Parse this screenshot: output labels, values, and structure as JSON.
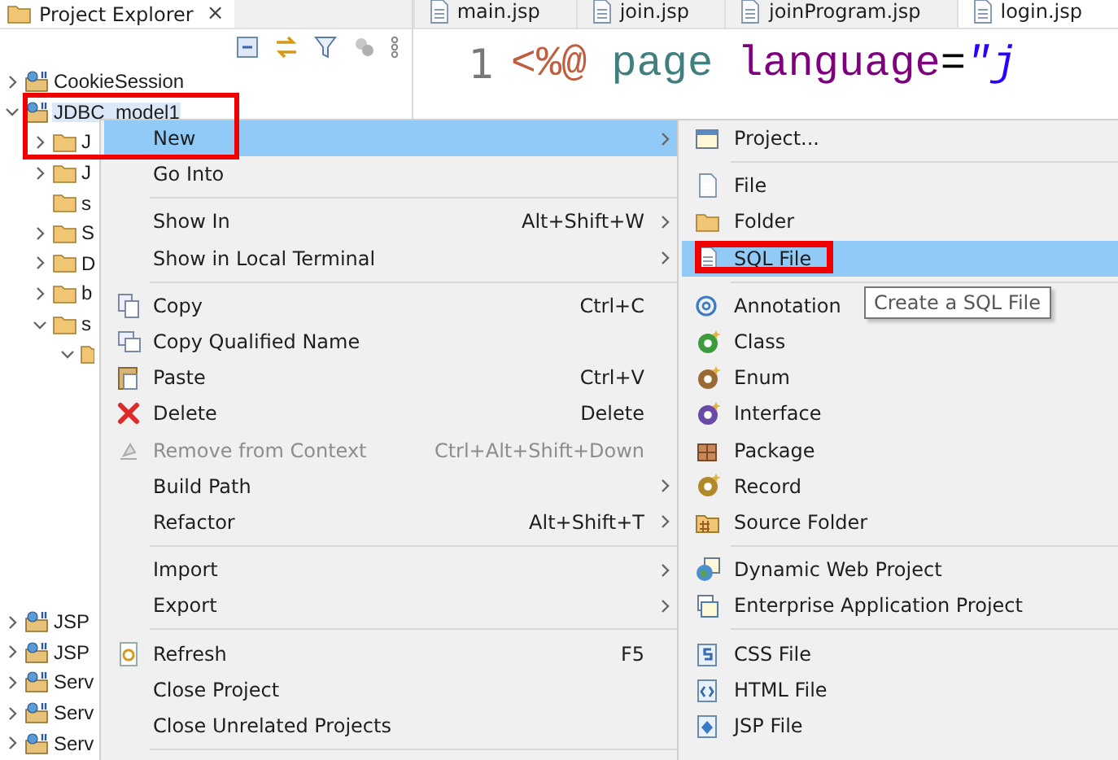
{
  "explorer": {
    "title": "Project Explorer",
    "close": "×",
    "tree": [
      {
        "label": "CookieSession",
        "expanded": false,
        "selected": false
      },
      {
        "label": "JDBC_model1",
        "expanded": true,
        "selected": true,
        "children": [
          {
            "label": "J",
            "expanded": false,
            "selected": false
          },
          {
            "label": "J",
            "expanded": false,
            "selected": false
          },
          {
            "label": "s",
            "selected": false
          },
          {
            "label": "S",
            "expanded": false,
            "selected": false
          },
          {
            "label": "D",
            "expanded": false,
            "selected": false
          },
          {
            "label": "b",
            "expanded": false,
            "selected": false
          },
          {
            "label": "s",
            "expanded": true,
            "selected": false,
            "children": [
              {
                "expanded": true,
                "selected": false
              }
            ]
          }
        ]
      },
      {
        "label": "JSP",
        "expanded": false,
        "selected": false
      },
      {
        "label": "JSP",
        "expanded": false,
        "selected": false
      },
      {
        "label": "Serv",
        "expanded": false,
        "selected": false
      },
      {
        "label": "Serv",
        "expanded": false,
        "selected": false
      },
      {
        "label": "Serv",
        "expanded": false,
        "selected": false
      }
    ]
  },
  "editor": {
    "tabs": [
      {
        "label": "main.jsp",
        "selected": false
      },
      {
        "label": "join.jsp",
        "selected": false
      },
      {
        "label": "joinProgram.jsp",
        "selected": false
      },
      {
        "label": "login.jsp",
        "selected": true
      }
    ],
    "lines": [
      {
        "number": "1",
        "tokens": [
          {
            "kind": "directive",
            "text": "<%@"
          },
          {
            "kind": "tag",
            "text": "page"
          },
          {
            "kind": "attribute",
            "text": "language"
          },
          {
            "kind": "plain",
            "text": "="
          },
          {
            "kind": "string",
            "text": "\"j"
          }
        ]
      }
    ]
  },
  "context_menu": {
    "items": [
      {
        "kind": "item",
        "label": "New",
        "has_submenu": true,
        "selected": true,
        "disabled": false
      },
      {
        "kind": "item",
        "label": "Go Into",
        "has_submenu": false,
        "selected": false,
        "disabled": false
      },
      {
        "kind": "separator"
      },
      {
        "kind": "item",
        "label": "Show In",
        "shortcut": "Alt+Shift+W",
        "has_submenu": true,
        "selected": false,
        "disabled": false
      },
      {
        "kind": "item",
        "label": "Show in Local Terminal",
        "has_submenu": true,
        "selected": false,
        "disabled": false
      },
      {
        "kind": "separator"
      },
      {
        "kind": "item",
        "label": "Copy",
        "shortcut": "Ctrl+C",
        "has_submenu": false,
        "selected": false,
        "disabled": false
      },
      {
        "kind": "item",
        "label": "Copy Qualified Name",
        "has_submenu": false,
        "selected": false,
        "disabled": false
      },
      {
        "kind": "item",
        "label": "Paste",
        "shortcut": "Ctrl+V",
        "has_submenu": false,
        "selected": false,
        "disabled": false
      },
      {
        "kind": "item",
        "label": "Delete",
        "shortcut": "Delete",
        "has_submenu": false,
        "selected": false,
        "disabled": false
      },
      {
        "kind": "item",
        "label": "Remove from Context",
        "shortcut": "Ctrl+Alt+Shift+Down",
        "has_submenu": false,
        "selected": false,
        "disabled": true
      },
      {
        "kind": "item",
        "label": "Build Path",
        "has_submenu": true,
        "selected": false,
        "disabled": false
      },
      {
        "kind": "item",
        "label": "Refactor",
        "shortcut": "Alt+Shift+T",
        "has_submenu": true,
        "selected": false,
        "disabled": false
      },
      {
        "kind": "separator"
      },
      {
        "kind": "item",
        "label": "Import",
        "has_submenu": true,
        "selected": false,
        "disabled": false
      },
      {
        "kind": "item",
        "label": "Export",
        "has_submenu": true,
        "selected": false,
        "disabled": false
      },
      {
        "kind": "separator"
      },
      {
        "kind": "item",
        "label": "Refresh",
        "shortcut": "F5",
        "has_submenu": false,
        "selected": false,
        "disabled": false
      },
      {
        "kind": "item",
        "label": "Close Project",
        "has_submenu": false,
        "selected": false,
        "disabled": false
      },
      {
        "kind": "item",
        "label": "Close Unrelated Projects",
        "has_submenu": false,
        "selected": false,
        "disabled": false
      },
      {
        "kind": "separator"
      }
    ]
  },
  "submenu": {
    "items": [
      {
        "kind": "item",
        "label": "Project...",
        "selected": false
      },
      {
        "kind": "separator"
      },
      {
        "kind": "item",
        "label": "File",
        "selected": false
      },
      {
        "kind": "item",
        "label": "Folder",
        "selected": false
      },
      {
        "kind": "item",
        "label": "SQL File",
        "selected": true
      },
      {
        "kind": "separator"
      },
      {
        "kind": "item",
        "label": "Annotation",
        "selected": false
      },
      {
        "kind": "item",
        "label": "Class",
        "selected": false
      },
      {
        "kind": "item",
        "label": "Enum",
        "selected": false
      },
      {
        "kind": "item",
        "label": "Interface",
        "selected": false
      },
      {
        "kind": "item",
        "label": "Package",
        "selected": false
      },
      {
        "kind": "item",
        "label": "Record",
        "selected": false
      },
      {
        "kind": "item",
        "label": "Source Folder",
        "selected": false
      },
      {
        "kind": "separator"
      },
      {
        "kind": "item",
        "label": "Dynamic Web Project",
        "selected": false
      },
      {
        "kind": "item",
        "label": "Enterprise Application Project",
        "selected": false
      },
      {
        "kind": "separator"
      },
      {
        "kind": "item",
        "label": "CSS File",
        "selected": false
      },
      {
        "kind": "item",
        "label": "HTML File",
        "selected": false
      },
      {
        "kind": "item",
        "label": "JSP File",
        "selected": false
      }
    ]
  },
  "tooltip": {
    "text": "Create a SQL File"
  }
}
